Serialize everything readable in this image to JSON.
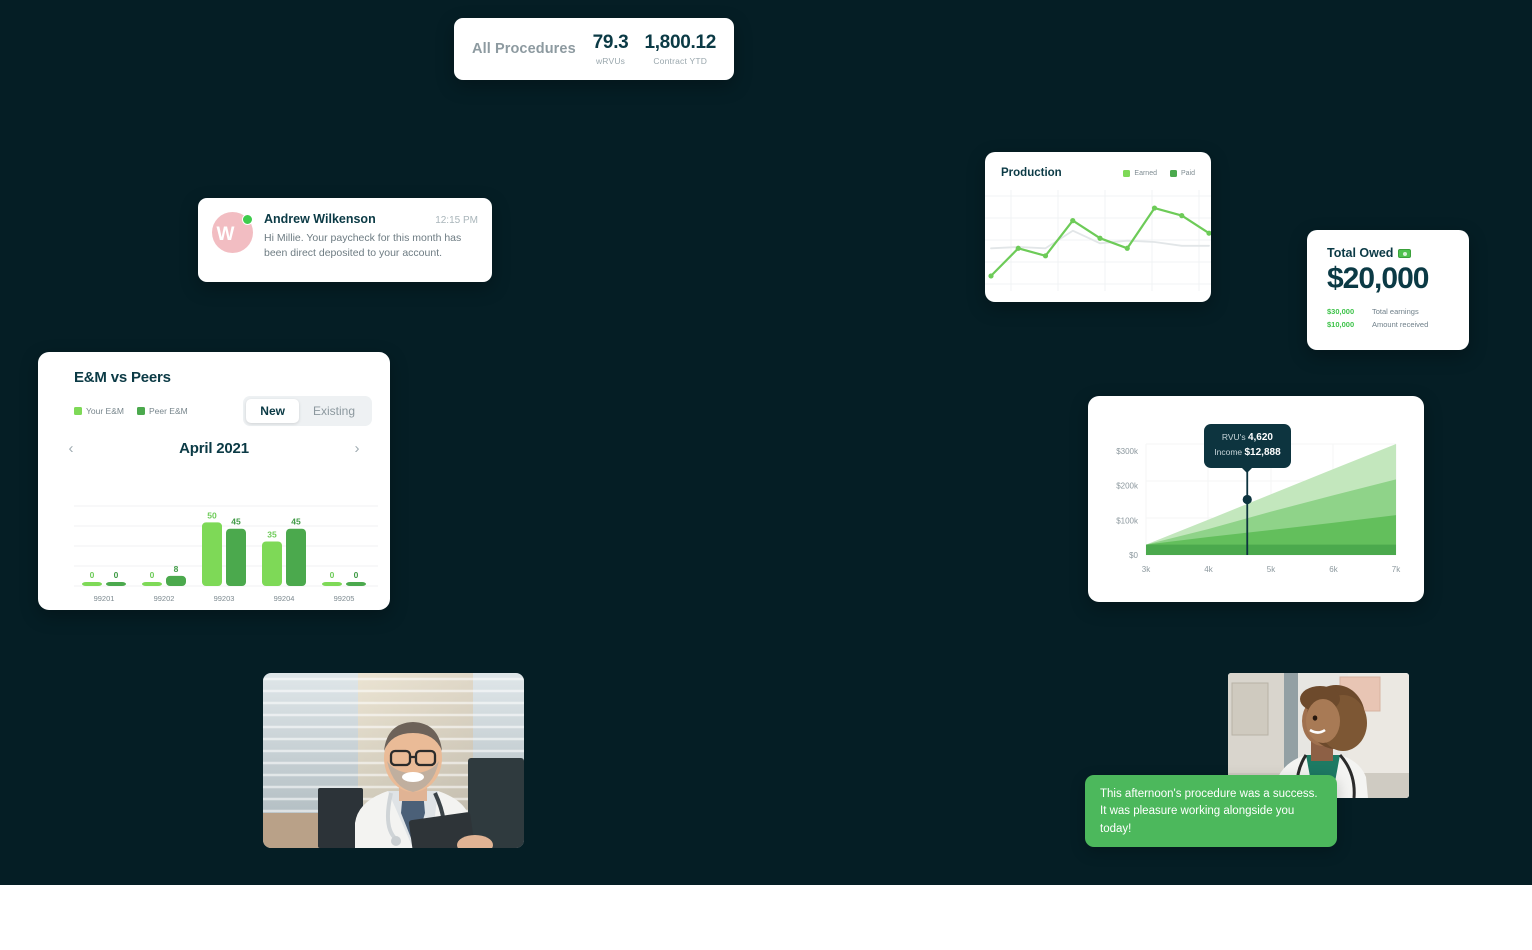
{
  "theme": {
    "background": "#051e25",
    "card_bg": "#ffffff",
    "brand_dark": "#0b3a45",
    "green_light": "#7ed957",
    "green_dark": "#4ba94d",
    "green_accent": "#3ec34a"
  },
  "all_procedures": {
    "title": "All Procedures",
    "stats": [
      {
        "value": "79.3",
        "label": "wRVUs"
      },
      {
        "value": "1,800.12",
        "label": "Contract YTD"
      }
    ]
  },
  "message": {
    "avatar_initial": "W",
    "status": "online",
    "sender": "Andrew Wilkenson",
    "time": "12:15 PM",
    "text": "Hi Millie. Your paycheck for this month has been direct deposited to your account."
  },
  "production": {
    "title": "Production",
    "legend": [
      {
        "label": "Earned",
        "color": "#7ed957"
      },
      {
        "label": "Paid",
        "color": "#4ba94d"
      }
    ],
    "chart_data": {
      "type": "line",
      "title": "Production",
      "xlabel": "",
      "ylabel": "",
      "grid": true,
      "legend_position": "top-right",
      "x": [
        1,
        2,
        3,
        4,
        5,
        6,
        7,
        8,
        9
      ],
      "series": [
        {
          "name": "Earned",
          "color": "#7ed957",
          "values": [
            8,
            30,
            24,
            52,
            38,
            30,
            62,
            56,
            42
          ]
        },
        {
          "name": "Paid",
          "color": "#dfe3e5",
          "values": [
            30,
            31,
            30,
            44,
            34,
            36,
            35,
            32,
            32
          ]
        }
      ]
    }
  },
  "total_owed": {
    "title": "Total Owed",
    "icon": "money-icon",
    "amount": "$20,000",
    "breakdown": [
      {
        "amount": "$30,000",
        "label": "Total earnings"
      },
      {
        "amount": "$10,000",
        "label": "Amount received"
      }
    ]
  },
  "em_vs_peers": {
    "title": "E&M vs Peers",
    "legend": [
      {
        "label": "Your E&M",
        "color": "#7ed957"
      },
      {
        "label": "Peer E&M",
        "color": "#4ba94d"
      }
    ],
    "toggle": {
      "options": [
        "New",
        "Existing"
      ],
      "selected": "New"
    },
    "nav": {
      "prev": "‹",
      "next": "›",
      "period": "April 2021"
    },
    "chart_data": {
      "type": "bar",
      "title": "E&M vs Peers",
      "categories": [
        "99201",
        "99202",
        "99203",
        "99204",
        "99205"
      ],
      "series": [
        {
          "name": "Your E&M",
          "color": "#7ed957",
          "values": [
            0,
            0,
            50,
            35,
            0
          ]
        },
        {
          "name": "Peer E&M",
          "color": "#4ba94d",
          "values": [
            0,
            8,
            45,
            45,
            0
          ]
        }
      ],
      "ylim": [
        0,
        55
      ],
      "xlabel": "",
      "ylabel": "",
      "grid": true
    }
  },
  "income_projection": {
    "tooltip": {
      "rvu_label": "RVU's",
      "rvu_value": "4,620",
      "income_label": "Income",
      "income_value": "$12,888"
    },
    "chart_data": {
      "type": "area",
      "title": "",
      "xlabel": "",
      "ylabel": "",
      "x_ticks": [
        "3k",
        "4k",
        "5k",
        "6k",
        "7k"
      ],
      "y_ticks": [
        "$0",
        "$100k",
        "$200k",
        "$300k"
      ],
      "ylim": [
        0,
        320000
      ],
      "xlim": [
        3000,
        7000
      ],
      "grid": true,
      "marker": {
        "x": 4620,
        "y": 160000
      },
      "series": [
        {
          "name": "Band 1",
          "color": "#4ba94d",
          "values_at_x": [
            30000,
            30000,
            30000,
            30000,
            30000
          ]
        },
        {
          "name": "Band 2",
          "color": "#63bf5c",
          "values_at_x": [
            30000,
            52000,
            72000,
            93000,
            115000
          ]
        },
        {
          "name": "Band 3",
          "color": "#8fd389",
          "values_at_x": [
            30000,
            75000,
            125000,
            172000,
            218000
          ]
        },
        {
          "name": "Band 4",
          "color": "#c3e7bd",
          "values_at_x": [
            30000,
            102000,
            175000,
            248000,
            320000
          ]
        }
      ]
    }
  },
  "photos": [
    {
      "name": "doctor-male-photo",
      "alt": "Smiling male doctor with glasses holding a tablet"
    },
    {
      "name": "doctor-female-photo",
      "alt": "Smiling female doctor with curly hair"
    }
  ],
  "chat_bubble": {
    "text": "This afternoon's procedure was a success. It was pleasure working alongside you today!",
    "color": "#4cb85c"
  }
}
